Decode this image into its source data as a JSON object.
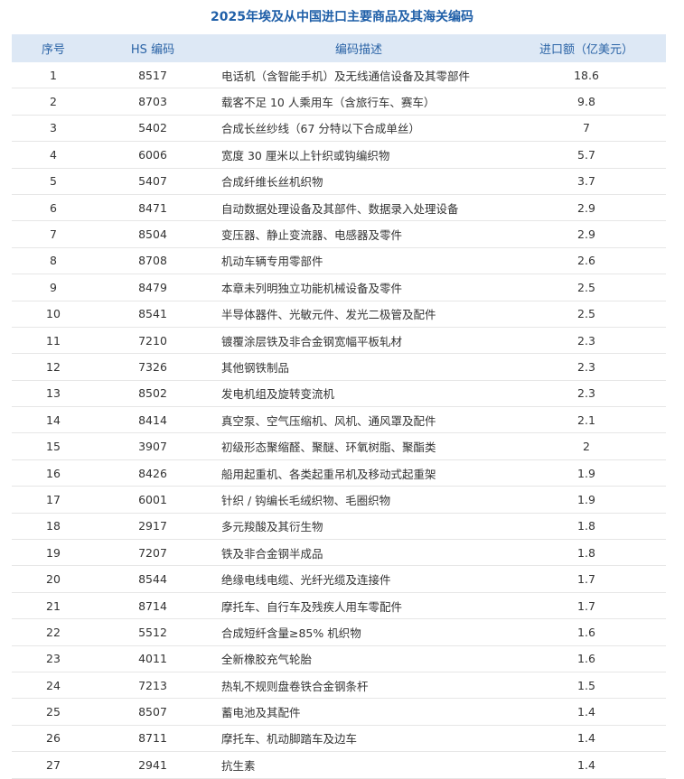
{
  "title": "2025年埃及从中国进口主要商品及其海关编码",
  "headers": {
    "no": "序号",
    "hs": "HS 编码",
    "desc": "编码描述",
    "value": "进口额（亿美元）"
  },
  "rows": [
    {
      "no": "1",
      "hs": "8517",
      "desc": "电话机（含智能手机）及无线通信设备及其零部件",
      "value": "18.6"
    },
    {
      "no": "2",
      "hs": "8703",
      "desc": "载客不足 10 人乘用车（含旅行车、赛车）",
      "value": "9.8"
    },
    {
      "no": "3",
      "hs": "5402",
      "desc": "合成长丝纱线（67 分特以下合成单丝）",
      "value": "7"
    },
    {
      "no": "4",
      "hs": "6006",
      "desc": "宽度 30 厘米以上针织或钩编织物",
      "value": "5.7"
    },
    {
      "no": "5",
      "hs": "5407",
      "desc": "合成纤维长丝机织物",
      "value": "3.7"
    },
    {
      "no": "6",
      "hs": "8471",
      "desc": "自动数据处理设备及其部件、数据录入处理设备",
      "value": "2.9"
    },
    {
      "no": "7",
      "hs": "8504",
      "desc": "变压器、静止变流器、电感器及零件",
      "value": "2.9"
    },
    {
      "no": "8",
      "hs": "8708",
      "desc": "机动车辆专用零部件",
      "value": "2.6"
    },
    {
      "no": "9",
      "hs": "8479",
      "desc": "本章未列明独立功能机械设备及零件",
      "value": "2.5"
    },
    {
      "no": "10",
      "hs": "8541",
      "desc": "半导体器件、光敏元件、发光二极管及配件",
      "value": "2.5"
    },
    {
      "no": "11",
      "hs": "7210",
      "desc": "镀覆涂层铁及非合金钢宽幅平板轧材",
      "value": "2.3"
    },
    {
      "no": "12",
      "hs": "7326",
      "desc": "其他钢铁制品",
      "value": "2.3"
    },
    {
      "no": "13",
      "hs": "8502",
      "desc": "发电机组及旋转变流机",
      "value": "2.3"
    },
    {
      "no": "14",
      "hs": "8414",
      "desc": "真空泵、空气压缩机、风机、通风罩及配件",
      "value": "2.1"
    },
    {
      "no": "15",
      "hs": "3907",
      "desc": "初级形态聚缩醛、聚醚、环氧树脂、聚酯类",
      "value": "2"
    },
    {
      "no": "16",
      "hs": "8426",
      "desc": "船用起重机、各类起重吊机及移动式起重架",
      "value": "1.9"
    },
    {
      "no": "17",
      "hs": "6001",
      "desc": "针织 / 钩编长毛绒织物、毛圈织物",
      "value": "1.9"
    },
    {
      "no": "18",
      "hs": "2917",
      "desc": "多元羧酸及其衍生物",
      "value": "1.8"
    },
    {
      "no": "19",
      "hs": "7207",
      "desc": "铁及非合金钢半成品",
      "value": "1.8"
    },
    {
      "no": "20",
      "hs": "8544",
      "desc": "绝缘电线电缆、光纤光缆及连接件",
      "value": "1.7"
    },
    {
      "no": "21",
      "hs": "8714",
      "desc": "摩托车、自行车及残疾人用车零配件",
      "value": "1.7"
    },
    {
      "no": "22",
      "hs": "5512",
      "desc": "合成短纤含量≥85% 机织物",
      "value": "1.6"
    },
    {
      "no": "23",
      "hs": "4011",
      "desc": "全新橡胶充气轮胎",
      "value": "1.6"
    },
    {
      "no": "24",
      "hs": "7213",
      "desc": "热轧不规则盘卷铁合金钢条杆",
      "value": "1.5"
    },
    {
      "no": "25",
      "hs": "8507",
      "desc": "蓄电池及其配件",
      "value": "1.4"
    },
    {
      "no": "26",
      "hs": "8711",
      "desc": "摩托车、机动脚踏车及边车",
      "value": "1.4"
    },
    {
      "no": "27",
      "hs": "2941",
      "desc": "抗生素",
      "value": "1.4"
    }
  ],
  "colors": {
    "title": "#1f5fa8",
    "header_bg": "#dde8f5",
    "header_text": "#2a63a6",
    "row_divider": "#e6e6e6"
  }
}
